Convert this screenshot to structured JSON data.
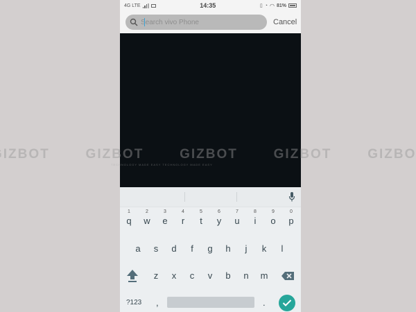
{
  "status_bar": {
    "network": "4G LTE",
    "time": "14:35",
    "battery": "81%"
  },
  "search": {
    "placeholder": "Search vivo Phone",
    "cancel_label": "Cancel"
  },
  "watermark": {
    "words": [
      "GIZBOT",
      "GIZBOT",
      "GIZBOT",
      "GIZBOT",
      "GIZBOT"
    ],
    "tagline": "TECHNOLOGY MADE EASY  TECHNOLOGY MADE EASY"
  },
  "keyboard": {
    "row1": [
      {
        "key": "q",
        "hint": "1"
      },
      {
        "key": "w",
        "hint": "2"
      },
      {
        "key": "e",
        "hint": "3"
      },
      {
        "key": "r",
        "hint": "4"
      },
      {
        "key": "t",
        "hint": "5"
      },
      {
        "key": "y",
        "hint": "6"
      },
      {
        "key": "u",
        "hint": "7"
      },
      {
        "key": "i",
        "hint": "8"
      },
      {
        "key": "o",
        "hint": "9"
      },
      {
        "key": "p",
        "hint": "0"
      }
    ],
    "row2": [
      "a",
      "s",
      "d",
      "f",
      "g",
      "h",
      "j",
      "k",
      "l"
    ],
    "row3": [
      "z",
      "x",
      "c",
      "v",
      "b",
      "n",
      "m"
    ],
    "symbols_label": "?123",
    "comma": ",",
    "period": "."
  },
  "colors": {
    "enter_button": "#26a69a",
    "search_caret": "#3aa3d6",
    "background": "#d3cfcf"
  },
  "icons": [
    "search-icon",
    "microphone-icon",
    "shift-icon",
    "backspace-icon",
    "checkmark-icon"
  ]
}
